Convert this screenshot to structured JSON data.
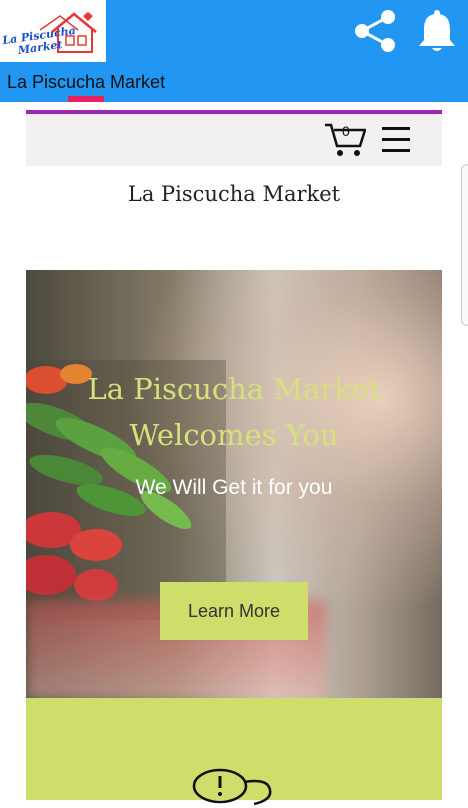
{
  "appbar": {
    "title": "La Piscucha Market",
    "logo_text_line1": "La Piscucha",
    "logo_text_line2": "Market",
    "bg_color": "#2196f3",
    "tab_indicator_color": "#e91e63",
    "icons": [
      "share-icon",
      "bell-icon"
    ]
  },
  "site": {
    "cart_count": "0",
    "title": "La Piscucha Market",
    "accent_color": "#9c27b0"
  },
  "hero": {
    "heading_line1": "La Piscucha Market",
    "heading_line2": "Welcomes You",
    "subheading": "We Will Get it for you",
    "button_label": "Learn More",
    "heading_color": "#d7e07a",
    "button_color": "#cfdd6a"
  }
}
